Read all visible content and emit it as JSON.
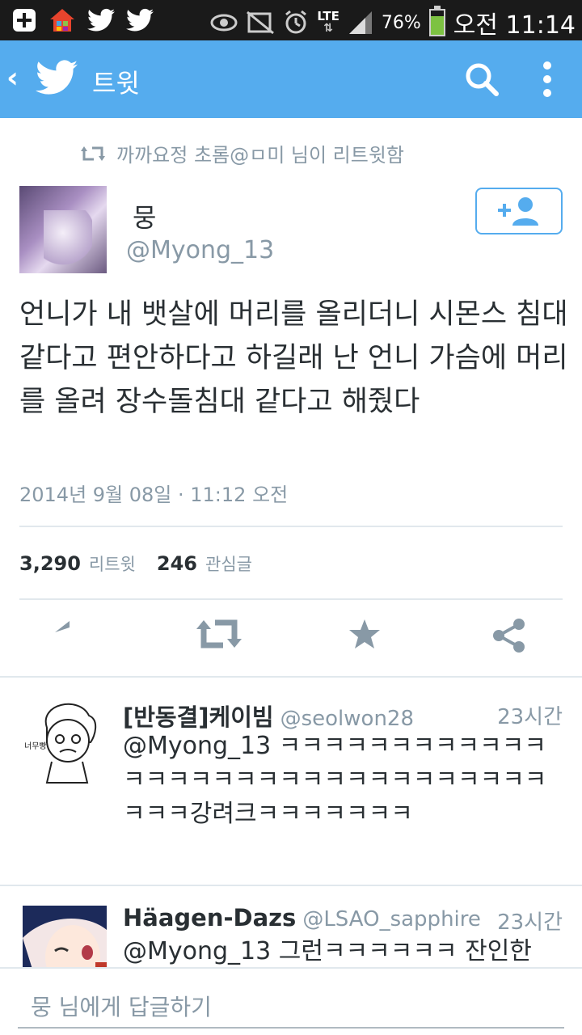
{
  "status_bar": {
    "network": "LTE",
    "battery_percent": "76%",
    "battery_level": 0.76,
    "time": "오전 11:14"
  },
  "action_bar": {
    "back_label": "‹",
    "title": "트윗"
  },
  "retweet_header": {
    "text": "까까요정 초롬@ㅁ미 님이 리트윗함"
  },
  "tweet": {
    "author_name": "뭉",
    "author_handle": "@Myong_13",
    "text": "언니가 내 뱃살에 머리를 올리더니 시몬스 침대같다고 편안하다고 하길래 난 언니 가슴에 머리를 올려 장수돌침대 같다고 해줬다",
    "timestamp": "2014년 9월 08일 · 11:12 오전",
    "retweet_count": "3,290",
    "retweet_label": "리트윗",
    "favorite_count": "246",
    "favorite_label": "관심글"
  },
  "replies": [
    {
      "name": "[반동결]케이빔",
      "handle": "@seolwon28",
      "time": "23시간",
      "text": "@Myong_13 ㅋㅋㅋㅋㅋㅋㅋㅋㅋㅋㅋㅋㅋㅋㅋㅋㅋㅋㅋㅋㅋㅋㅋㅋㅋㅋㅋㅋㅋㅋㅋㅋㅋㅋ강려크ㅋㅋㅋㅋㅋㅋㅋ",
      "avatar_label": "너무빵"
    },
    {
      "name": "Häagen-Dazs",
      "handle": "@LSAO_sapphire",
      "time": "23시간",
      "text": "@Myong_13 그런ㅋㅋㅋㅋㅋㅋ 잔인한"
    }
  ],
  "reply_bar": {
    "placeholder": "뭉 님에게 답글하기"
  },
  "colors": {
    "accent": "#55acee",
    "text": "#292f33",
    "muted": "#8899a6",
    "divider": "#e1e8ed"
  }
}
